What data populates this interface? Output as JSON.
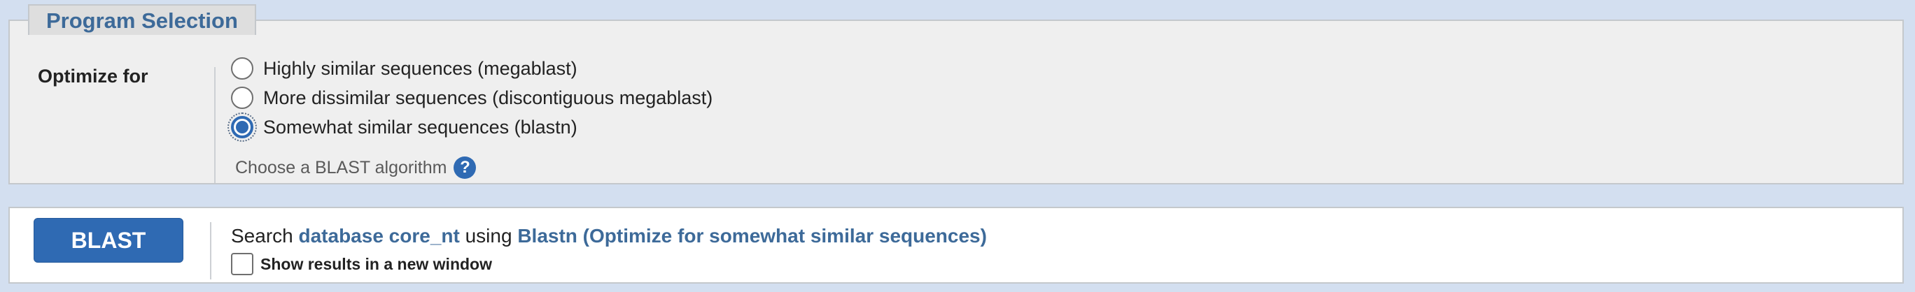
{
  "program_selection": {
    "legend": "Program Selection",
    "optimize_label": "Optimize for",
    "options": [
      {
        "label": "Highly similar sequences (megablast)",
        "checked": false
      },
      {
        "label": "More dissimilar sequences (discontiguous megablast)",
        "checked": false
      },
      {
        "label": "Somewhat similar sequences (blastn)",
        "checked": true
      }
    ],
    "hint": "Choose a BLAST algorithm",
    "help_icon": "question-icon"
  },
  "submit": {
    "button_label": "BLAST",
    "search_prefix": "Search",
    "database_link": "database core_nt",
    "using_text": "using",
    "program_link": "Blastn (Optimize for somewhat similar sequences)",
    "new_window_label": "Show results in a new window",
    "new_window_checked": false
  },
  "colors": {
    "accent": "#2f6ab3",
    "link": "#3d6a99",
    "background": "#d3dff0"
  }
}
